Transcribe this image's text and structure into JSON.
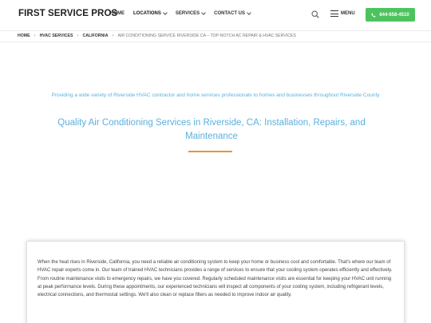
{
  "header": {
    "logo": "FIRST SERVICE PROS",
    "nav": [
      {
        "label": "HOME"
      },
      {
        "label": "LOCATIONS"
      },
      {
        "label": "SERVICES"
      },
      {
        "label": "CONTACT US"
      }
    ],
    "menu_label": "MENU",
    "phone": "644-658-4510",
    "accent_color": "#4cc35e"
  },
  "breadcrumb": [
    {
      "label": "HOME"
    },
    {
      "label": "HVAC SERVICES"
    },
    {
      "label": "CALIFORNIA"
    },
    {
      "label": "AIR CONDITIONING SERVICE RIVERSIDE CA – TOP-NOTCH AC REPAIR & HVAC SERVICES"
    }
  ],
  "hero": {
    "tagline": "Providing a wide variety of Riverside HVAC contractor and home services professionals to homes and businesses throughout Riverside County",
    "heading": "Quality Air Conditioning Services in Riverside, CA: Installation, Repairs, and Maintenance",
    "heading_color": "#5bb0dc",
    "underline_color": "#e8952d"
  },
  "body": {
    "paragraph": "When the heat rises in Riverside, California, you need a reliable air conditioning system to keep your home or business cool and comfortable. That's where our team of HVAC repair experts come in. Our team of trained HVAC technicians provides a range of services to ensure that your cooling system operates efficiently and effectively. From routine maintenance visits to emergency repairs, we have you covered. Regularly scheduled maintenance visits are essential for keeping your HVAC unit running at peak performance levels. During these appointments, our experienced technicians will inspect all components of your cooling system, including refrigerant levels, electrical connections, and thermostat settings. We'll also clean or replace filters as needed to improve indoor air quality."
  }
}
